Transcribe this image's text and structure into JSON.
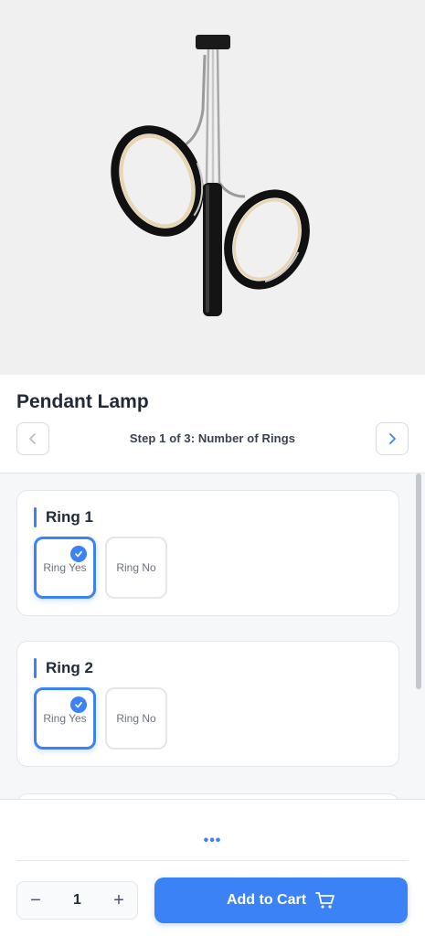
{
  "product": {
    "title": "Pendant Lamp"
  },
  "stepper": {
    "step_text": "Step 1 of 3: Number of Rings",
    "prev_icon": "chevron-left-icon",
    "next_icon": "chevron-right-icon"
  },
  "groups": [
    {
      "title": "Ring 1",
      "options": [
        {
          "label": "Ring Yes",
          "selected": true
        },
        {
          "label": "Ring No",
          "selected": false
        }
      ]
    },
    {
      "title": "Ring 2",
      "options": [
        {
          "label": "Ring Yes",
          "selected": true
        },
        {
          "label": "Ring No",
          "selected": false
        }
      ]
    }
  ],
  "more_indicator": "•••",
  "quantity": {
    "minus": "−",
    "value": "1",
    "plus": "+"
  },
  "cart": {
    "label": "Add to Cart",
    "icon": "cart-icon"
  },
  "colors": {
    "accent": "#3b82f6",
    "hero_bg": "#f0f0f1"
  }
}
